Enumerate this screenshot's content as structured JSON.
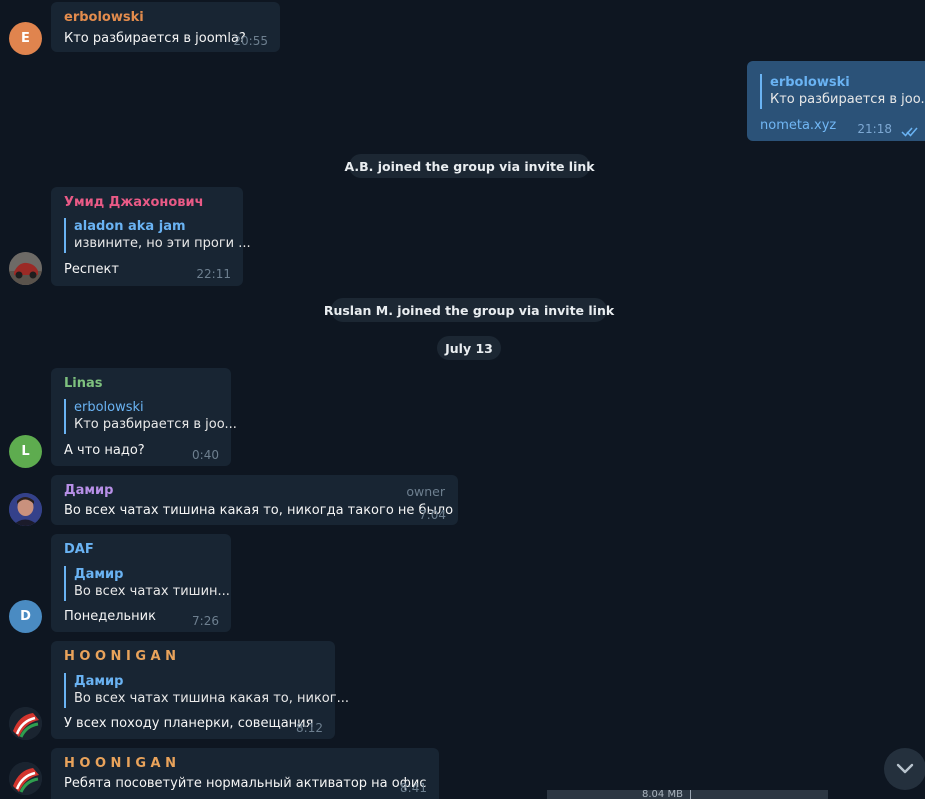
{
  "messages": {
    "m1": {
      "sender": "erbolowski",
      "text": "Кто разбирается в joomla?",
      "time": "20:55",
      "avatar_letter": "E"
    },
    "m2": {
      "reply_name": "erbolowski",
      "reply_text": "Кто разбирается в joo...",
      "text": "nometa.xyz",
      "time": "21:18"
    },
    "m3": {
      "sender": "Умид Джахонович",
      "reply_name": "aladon aka jam",
      "reply_text": "извините, но эти проги ...",
      "text": "Респект",
      "time": "22:11"
    },
    "m4": {
      "sender": "Linas",
      "reply_name": "erbolowski",
      "reply_text": "Кто разбирается в joo...",
      "text": "А что надо?",
      "time": "0:40",
      "avatar_letter": "L"
    },
    "m5": {
      "sender": "Дамир",
      "badge": "owner",
      "text": "Во всех чатах тишина какая то, никогда такого не было",
      "time": "7:04"
    },
    "m6": {
      "sender": "DAF",
      "reply_name": "Дамир",
      "reply_text": "Во всех чатах тишин...",
      "text": "Понедельник",
      "time": "7:26",
      "avatar_letter": "D"
    },
    "m7": {
      "sender": "H O O N I G A N",
      "reply_name": "Дамир",
      "reply_text": "Во всех чатах тишина какая то, никог...",
      "text": "У всех походу планерки, совещания",
      "time": "8:12"
    },
    "m8": {
      "sender": "H O O N I G A N",
      "text": "Ребята посоветуйте нормальный активатор на офис",
      "time": "8:41"
    }
  },
  "service": {
    "joined1": "A.B. joined the group via invite link",
    "joined2": "Ruslan M. joined the group via invite link",
    "date": "July 13"
  },
  "bottom_strip": {
    "size_text": "8.04 MB"
  },
  "colors": {
    "background": "#0e1621",
    "incoming_bubble": "#182533",
    "outgoing_bubble": "#2b5278",
    "reply_accent": "#6ab3f3",
    "name_erbolowski": "#e38c4d",
    "name_umid": "#e95a86",
    "name_linas": "#7ec17e",
    "name_damir": "#b890e8",
    "name_daf": "#6ab3f3",
    "name_hoonigan": "#e9a35b"
  },
  "icons": {
    "read_status": "double-check-icon",
    "scroll": "chevron-down-icon"
  }
}
